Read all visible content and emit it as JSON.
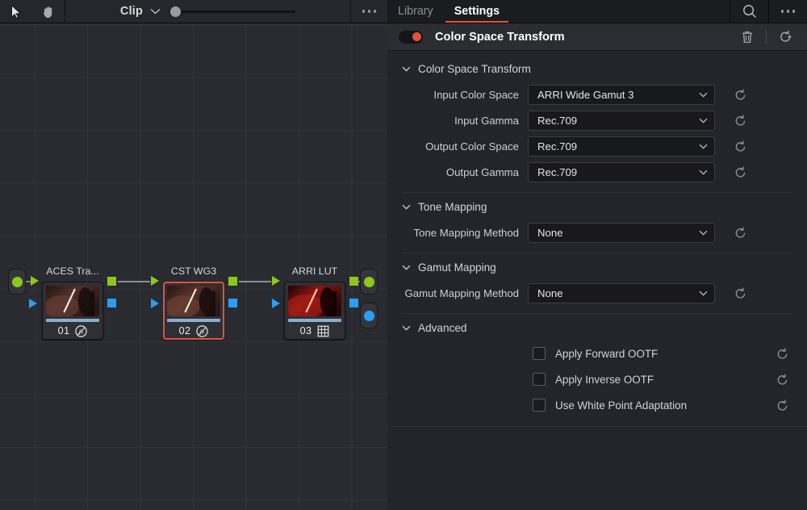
{
  "node_editor": {
    "toolbar": {
      "cursor_icon": "arrow-cursor-icon",
      "hand_icon": "hand-pan-icon",
      "mode_label": "Clip",
      "mode_caret_icon": "chevron-down-icon",
      "zoom_value": 0,
      "more_icon": "ellipsis-icon"
    },
    "source_port_label": "source-node",
    "output_port_label": "output-node",
    "output_alpha_label": "output-alpha-node",
    "nodes": [
      {
        "title": "ACES Tra...",
        "number": "01",
        "badge": "fx",
        "badge_icon": "fx-circle-icon",
        "selected": false,
        "thumb_style": "warm-dark"
      },
      {
        "title": "CST WG3",
        "number": "02",
        "badge": "fx",
        "badge_icon": "fx-circle-icon",
        "selected": true,
        "thumb_style": "warm-dark"
      },
      {
        "title": "ARRI LUT",
        "number": "03",
        "badge": "lut",
        "badge_icon": "lut-grid-icon",
        "selected": false,
        "thumb_style": "hot-red"
      }
    ]
  },
  "inspector": {
    "tabs": [
      {
        "label": "Library",
        "active": false
      },
      {
        "label": "Settings",
        "active": true
      }
    ],
    "search_icon": "search-icon",
    "more_icon": "ellipsis-icon",
    "effect": {
      "enabled": true,
      "title": "Color Space Transform",
      "toggle_color": "#e2513a",
      "delete_icon": "trash-icon",
      "reset_all_icon": "reset-all-icon"
    },
    "groups": [
      {
        "name": "Color Space Transform",
        "expanded": true,
        "caret_icon": "chevron-down-icon",
        "rows": [
          {
            "label": "Input Color Space",
            "value": "ARRI Wide Gamut 3",
            "control": "dropdown",
            "reset_icon": "reset-icon"
          },
          {
            "label": "Input Gamma",
            "value": "Rec.709",
            "control": "dropdown",
            "reset_icon": "reset-icon"
          },
          {
            "label": "Output Color Space",
            "value": "Rec.709",
            "control": "dropdown",
            "reset_icon": "reset-icon"
          },
          {
            "label": "Output Gamma",
            "value": "Rec.709",
            "control": "dropdown",
            "reset_icon": "reset-icon"
          }
        ]
      },
      {
        "name": "Tone Mapping",
        "expanded": true,
        "caret_icon": "chevron-down-icon",
        "rows": [
          {
            "label": "Tone Mapping Method",
            "value": "None",
            "control": "dropdown",
            "reset_icon": "reset-icon"
          }
        ]
      },
      {
        "name": "Gamut Mapping",
        "expanded": true,
        "caret_icon": "chevron-down-icon",
        "rows": [
          {
            "label": "Gamut Mapping Method",
            "value": "None",
            "control": "dropdown",
            "reset_icon": "reset-icon"
          }
        ]
      },
      {
        "name": "Advanced",
        "expanded": true,
        "caret_icon": "chevron-down-icon",
        "checkboxes": [
          {
            "label": "Apply Forward OOTF",
            "checked": false,
            "reset_icon": "reset-icon"
          },
          {
            "label": "Apply Inverse OOTF",
            "checked": false,
            "reset_icon": "reset-icon"
          },
          {
            "label": "Use White Point Adaptation",
            "checked": false,
            "reset_icon": "reset-icon"
          }
        ]
      }
    ]
  }
}
